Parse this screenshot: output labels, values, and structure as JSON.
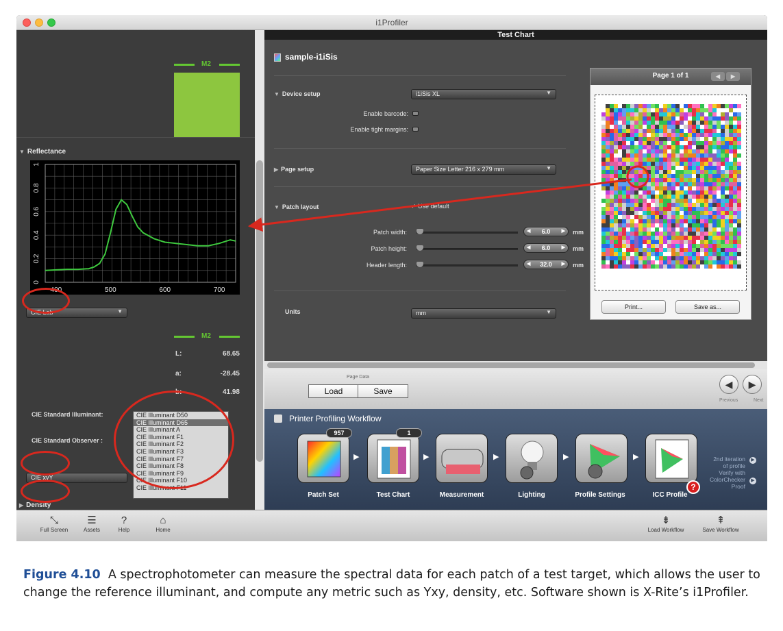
{
  "window": {
    "title": "i1Profiler",
    "tab_title": "Test Chart"
  },
  "left_panel": {
    "swatch_label": "M2",
    "swatch_color": "#8dc63f",
    "reflectance": {
      "title": "Reflectance",
      "chart_data": {
        "type": "line",
        "x": [
          380,
          400,
          420,
          440,
          460,
          470,
          480,
          490,
          500,
          510,
          520,
          530,
          540,
          550,
          560,
          580,
          600,
          620,
          640,
          660,
          680,
          700,
          720,
          730
        ],
        "series": [
          {
            "values": [
              0.1,
              0.105,
              0.11,
              0.11,
              0.115,
              0.13,
              0.16,
              0.24,
              0.42,
              0.62,
              0.7,
              0.66,
              0.56,
              0.47,
              0.42,
              0.37,
              0.34,
              0.33,
              0.32,
              0.31,
              0.31,
              0.33,
              0.36,
              0.35
            ]
          }
        ],
        "xlim": [
          380,
          730
        ],
        "ylim": [
          0,
          1.0
        ],
        "x_ticks": [
          "400",
          "500",
          "600",
          "700"
        ],
        "y_ticks": [
          "0",
          "0.2",
          "0.4",
          "0.6",
          "0.8",
          "1"
        ],
        "grid": true,
        "line_color": "#3ec83e"
      }
    },
    "color_space_select": "CIE Lab",
    "lab_label": "M2",
    "lab": [
      {
        "key": "L:",
        "value": "68.65"
      },
      {
        "key": "a:",
        "value": "-28.45"
      },
      {
        "key": "b:",
        "value": "41.98"
      }
    ],
    "illuminant_label": "CIE Standard Illuminant:",
    "observer_label": "CIE Standard Observer :",
    "illuminants": [
      "CIE Illuminant D50",
      "CIE Illuminant D65",
      "CIE Illuminant A",
      "CIE Illuminant F1",
      "CIE Illuminant F2",
      "CIE Illuminant F3",
      "CIE Illuminant F7",
      "CIE Illuminant F8",
      "CIE Illuminant F9",
      "CIE Illuminant F10",
      "CIE Illuminant F11"
    ],
    "xyY_select": "CIE xyY",
    "density_label": "Density"
  },
  "main": {
    "doc_title": "sample-i1iSis",
    "device_setup": {
      "label": "Device setup",
      "value": "i1iSis XL",
      "enable_barcode": "Enable barcode:",
      "enable_tight": "Enable tight margins:"
    },
    "page_setup": {
      "label": "Page setup",
      "value": "Paper Size Letter  216 x 279 mm"
    },
    "patch_layout": {
      "label": "Patch layout",
      "use_default": "Use default",
      "width_label": "Patch width:",
      "width_value": "6.0",
      "height_label": "Patch height:",
      "height_value": "6.0",
      "header_label": "Header length:",
      "header_value": "32.0",
      "unit": "mm"
    },
    "units": {
      "label": "Units",
      "value": "mm"
    },
    "preview": {
      "page": "Page 1 of 1",
      "print": "Print...",
      "save_as": "Save as..."
    }
  },
  "page_data": {
    "label": "Page Data",
    "load": "Load",
    "save": "Save",
    "previous": "Previous",
    "next": "Next"
  },
  "workflow": {
    "title": "Printer Profiling Workflow",
    "steps": [
      {
        "label": "Patch Set",
        "badge": "957"
      },
      {
        "label": "Test Chart",
        "badge": "1"
      },
      {
        "label": "Measurement"
      },
      {
        "label": "Lighting"
      },
      {
        "label": "Profile Settings"
      },
      {
        "label": "ICC Profile"
      }
    ],
    "iteration": [
      "2nd iteration",
      "of profile"
    ],
    "verify": [
      "Verify with",
      "ColorChecker",
      "Proof"
    ]
  },
  "toolbar": {
    "full_screen": "Full Screen",
    "assets": "Assets",
    "help": "Help",
    "home": "Home",
    "load_workflow": "Load Workflow",
    "save_workflow": "Save Workflow"
  },
  "caption": {
    "figure": "Figure 4.10",
    "text": "A spectrophotometer can measure the spectral data for each patch of a test target, which allows the user to change the reference illuminant, and compute any metric such as Yxy, density, etc. Software shown is X-Rite’s i1Profiler."
  },
  "annotation_color": "#d8281e"
}
